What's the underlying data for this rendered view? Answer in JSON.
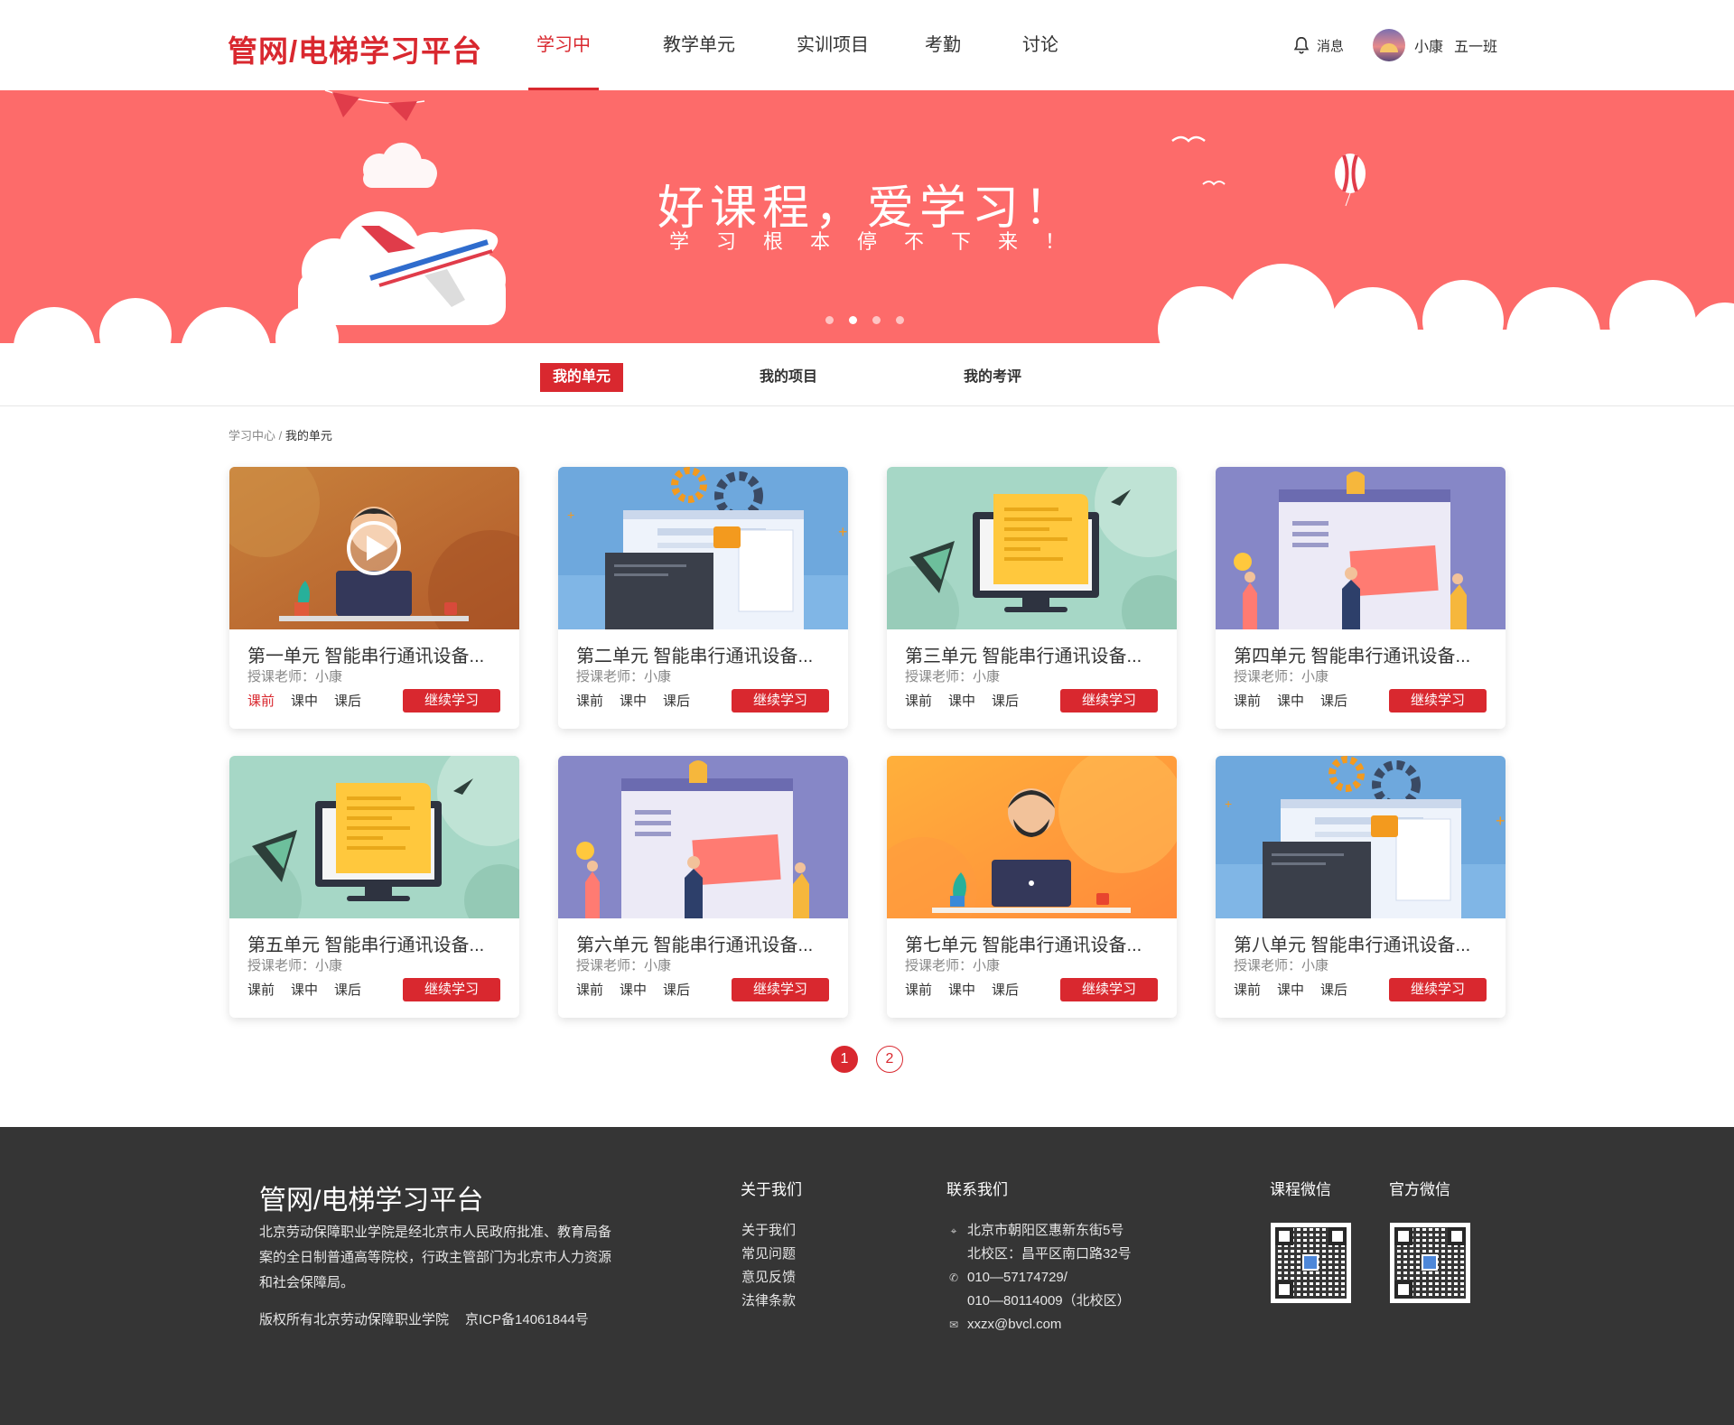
{
  "header": {
    "logo": "管网/电梯学习平台",
    "nav": [
      {
        "label": "学习中心",
        "active": true
      },
      {
        "label": "教学单元",
        "active": false
      },
      {
        "label": "实训项目",
        "active": false
      },
      {
        "label": "考勤",
        "active": false
      },
      {
        "label": "讨论",
        "active": false
      }
    ],
    "messages_label": "消息",
    "user_name": "小康",
    "user_class": "五一班"
  },
  "banner": {
    "title": "好课程，爱学习！",
    "subtitle": "学习根本停不下来！",
    "slide_count": 4,
    "active_slide": 2
  },
  "tabs": [
    {
      "label": "我的单元",
      "active": true
    },
    {
      "label": "我的项目",
      "active": false
    },
    {
      "label": "我的考评",
      "active": false
    }
  ],
  "breadcrumb": {
    "root": "学习中心",
    "separator": " / ",
    "current": "我的单元"
  },
  "cards": [
    {
      "title": "第一单元 智能串行通讯设备...",
      "teacher": "授课老师：小康",
      "stages": [
        "课前",
        "课中",
        "课后"
      ],
      "active_stage": 0,
      "button": "继续学习",
      "illustration": "video-teacher"
    },
    {
      "title": "第二单元 智能串行通讯设备...",
      "teacher": "授课老师：小康",
      "stages": [
        "课前",
        "课中",
        "课后"
      ],
      "active_stage": -1,
      "button": "继续学习",
      "illustration": "web-gears"
    },
    {
      "title": "第三单元 智能串行通讯设备...",
      "teacher": "授课老师：小康",
      "stages": [
        "课前",
        "课中",
        "课后"
      ],
      "active_stage": -1,
      "button": "继续学习",
      "illustration": "monitor-code"
    },
    {
      "title": "第四单元 智能串行通讯设备...",
      "teacher": "授课老师：小康",
      "stages": [
        "课前",
        "课中",
        "课后"
      ],
      "active_stage": -1,
      "button": "继续学习",
      "illustration": "team-website"
    },
    {
      "title": "第五单元 智能串行通讯设备...",
      "teacher": "授课老师：小康",
      "stages": [
        "课前",
        "课中",
        "课后"
      ],
      "active_stage": -1,
      "button": "继续学习",
      "illustration": "monitor-code"
    },
    {
      "title": "第六单元 智能串行通讯设备...",
      "teacher": "授课老师：小康",
      "stages": [
        "课前",
        "课中",
        "课后"
      ],
      "active_stage": -1,
      "button": "继续学习",
      "illustration": "team-website"
    },
    {
      "title": "第七单元 智能串行通讯设备...",
      "teacher": "授课老师：小康",
      "stages": [
        "课前",
        "课中",
        "课后"
      ],
      "active_stage": -1,
      "button": "继续学习",
      "illustration": "man-laptop"
    },
    {
      "title": "第八单元 智能串行通讯设备...",
      "teacher": "授课老师：小康",
      "stages": [
        "课前",
        "课中",
        "课后"
      ],
      "active_stage": -1,
      "button": "继续学习",
      "illustration": "web-gears"
    }
  ],
  "pagination": {
    "pages": [
      "1",
      "2"
    ],
    "current": "1"
  },
  "footer": {
    "title": "管网/电梯学习平台",
    "description": "北京劳动保障职业学院是经北京市人民政府批准、教育局备案的全日制普通高等院校，行政主管部门为北京市人力资源和社会保障局。",
    "copyright": "版权所有北京劳动保障职业学院",
    "icp": "京ICP备14061844号",
    "about_title": "关于我们",
    "about_links": [
      "关于我们",
      "常见问题",
      "意见反馈",
      "法律条款"
    ],
    "contact_title": "联系我们",
    "address_1": "北京市朝阳区惠新东街5号",
    "address_2": "北校区：昌平区南口路32号",
    "phone_1": "010—57174729/",
    "phone_2": "010—80114009（北校区）",
    "email": "xxzx@bvcl.com",
    "qr_course_title": "课程微信",
    "qr_official_title": "官方微信"
  },
  "colors": {
    "accent": "#d9282f",
    "banner": "#fd6b6a",
    "footer": "#353535"
  }
}
